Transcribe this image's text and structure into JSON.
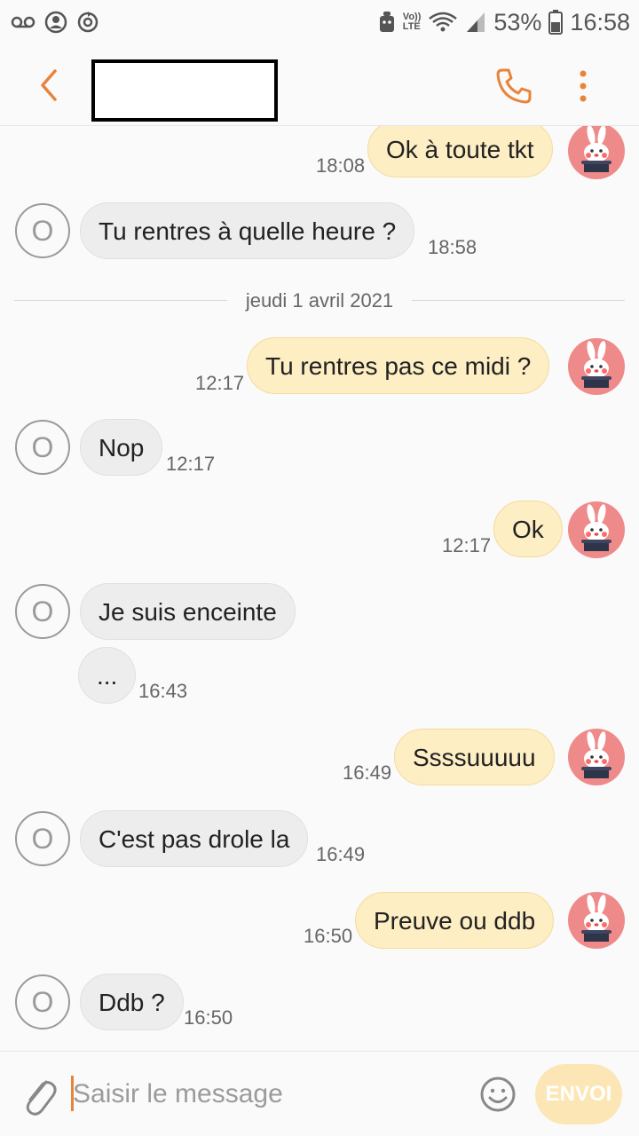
{
  "status_bar": {
    "battery_percent": "53%",
    "time": "16:58",
    "icons": [
      "voicemail-icon",
      "account-icon",
      "sync-icon",
      "android-icon",
      "volte-icon",
      "wifi-icon",
      "signal-icon",
      "battery-icon"
    ],
    "volte_label_top": "Vo))",
    "volte_label_bottom": "LTE"
  },
  "header": {
    "contact_name": "",
    "icons": [
      "back-icon",
      "phone-icon",
      "more-vert-icon"
    ]
  },
  "colors": {
    "accent": "#e8843a",
    "outgoing_bubble": "#fdeec3",
    "incoming_bubble": "#ededed",
    "send_button": "#fde6b6"
  },
  "thread": {
    "date_separator": "jeudi 1 avril 2021",
    "incoming_avatar_letter": "O",
    "messages": [
      {
        "direction": "out",
        "text": "Ok à toute tkt",
        "time": "18:08"
      },
      {
        "direction": "in",
        "text": "Tu rentres à quelle heure ?",
        "time": "18:58"
      },
      {
        "direction": "out",
        "text": "Tu rentres pas ce midi ?",
        "time": "12:17"
      },
      {
        "direction": "in",
        "text": "Nop",
        "time": "12:17"
      },
      {
        "direction": "out",
        "text": "Ok",
        "time": "12:17"
      },
      {
        "direction": "in",
        "text": "Je suis enceinte",
        "time": ""
      },
      {
        "direction": "in",
        "text": "...",
        "time": "16:43"
      },
      {
        "direction": "out",
        "text": "Ssssuuuuu",
        "time": "16:49"
      },
      {
        "direction": "in",
        "text": "C'est pas drole la",
        "time": "16:49"
      },
      {
        "direction": "out",
        "text": "Preuve ou ddb",
        "time": "16:50"
      },
      {
        "direction": "in",
        "text": "Ddb ?",
        "time": "16:50"
      }
    ]
  },
  "composer": {
    "placeholder": "Saisir le message",
    "value": "",
    "send_label": "ENVOI",
    "icons": [
      "attach-icon",
      "emoji-icon"
    ]
  }
}
